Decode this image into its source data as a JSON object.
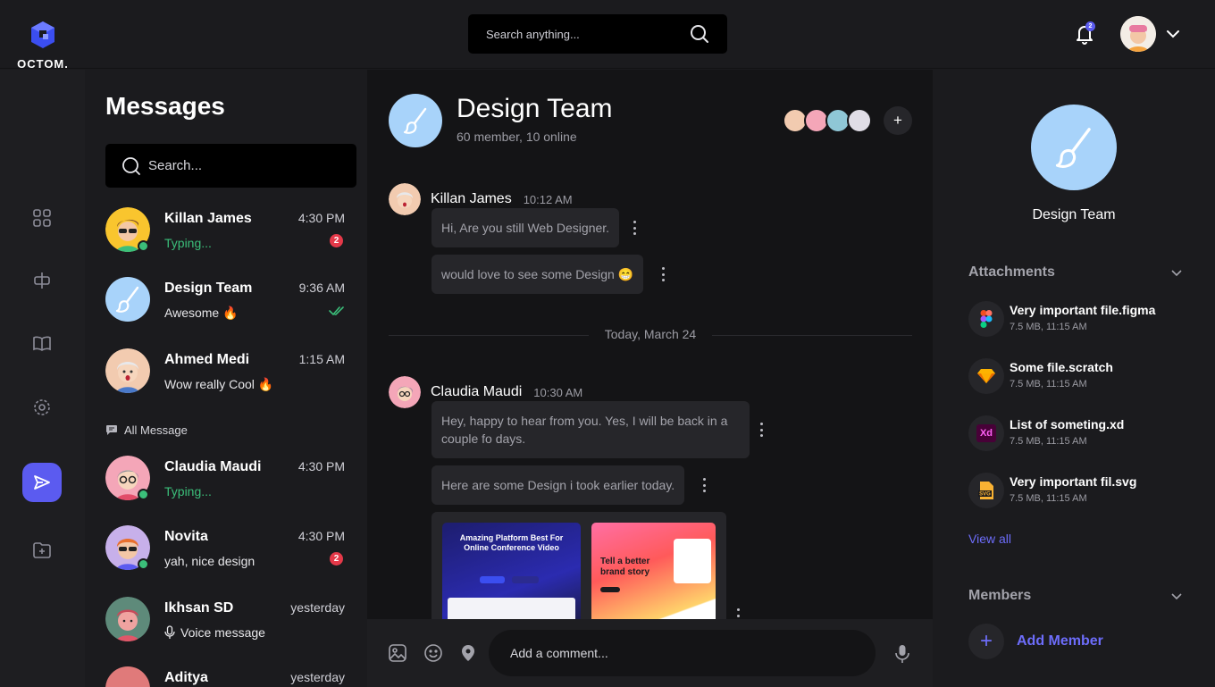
{
  "brand": {
    "name": "OCTOM."
  },
  "topbar": {
    "search_placeholder": "Search anything...",
    "notification_count": "2"
  },
  "messages": {
    "title": "Messages",
    "search_placeholder": "Search...",
    "pinned": [
      {
        "name": "Killan James",
        "time": "4:30 PM",
        "preview": "Typing...",
        "unread": "2"
      },
      {
        "name": "Design Team",
        "time": "9:36 AM",
        "preview": "Awesome 🔥"
      },
      {
        "name": "Ahmed Medi",
        "time": "1:15 AM",
        "preview": "Wow really Cool 🔥"
      }
    ],
    "all_label": "All Message",
    "all": [
      {
        "name": "Claudia Maudi",
        "time": "4:30 PM",
        "preview": "Typing..."
      },
      {
        "name": "Novita",
        "time": "4:30 PM",
        "preview": "yah, nice design",
        "unread": "2"
      },
      {
        "name": "Ikhsan SD",
        "time": "yesterday",
        "preview": "Voice message"
      },
      {
        "name": "Aditya",
        "time": "yesterday",
        "preview": ""
      }
    ]
  },
  "chat": {
    "title": "Design Team",
    "subtitle": "60 member, 10 online",
    "messages": [
      {
        "sender": "Killan James",
        "time": "10:12 AM",
        "bubbles": [
          "Hi, Are you still Web Designer.",
          "would love to see some Design 😁"
        ]
      },
      {
        "sender": "Claudia Maudi",
        "time": "10:30 AM",
        "bubbles": [
          "Hey, happy to hear from you. Yes, I will be back in a couple fo days.",
          "Here are some Design i took earlier today."
        ]
      }
    ],
    "divider": "Today, March 24",
    "thumb1_title": "Amazing Platform Best For Online Conference Video",
    "thumb2_title": "Tell a better brand story",
    "comment_placeholder": "Add a comment..."
  },
  "details": {
    "name": "Design Team",
    "attachments_label": "Attachments",
    "files": [
      {
        "name": "Very important file.figma",
        "meta": "7.5 MB, 11:15 AM",
        "icon": "figma-icon"
      },
      {
        "name": "Some file.scratch",
        "meta": "7.5 MB, 11:15 AM",
        "icon": "sketch-icon"
      },
      {
        "name": "List of someting.xd",
        "meta": "7.5 MB, 11:15 AM",
        "icon": "xd-icon"
      },
      {
        "name": "Very important fil.svg",
        "meta": "7.5 MB, 11:15 AM",
        "icon": "svg-file-icon"
      }
    ],
    "view_all": "View all",
    "members_label": "Members",
    "add_member": "Add Member"
  },
  "colors": {
    "accent": "#5b5bf0",
    "online": "#3bbf7a",
    "badge": "#e53949",
    "link": "#6d6dfb",
    "group_avatar": "#a8d3fa"
  }
}
